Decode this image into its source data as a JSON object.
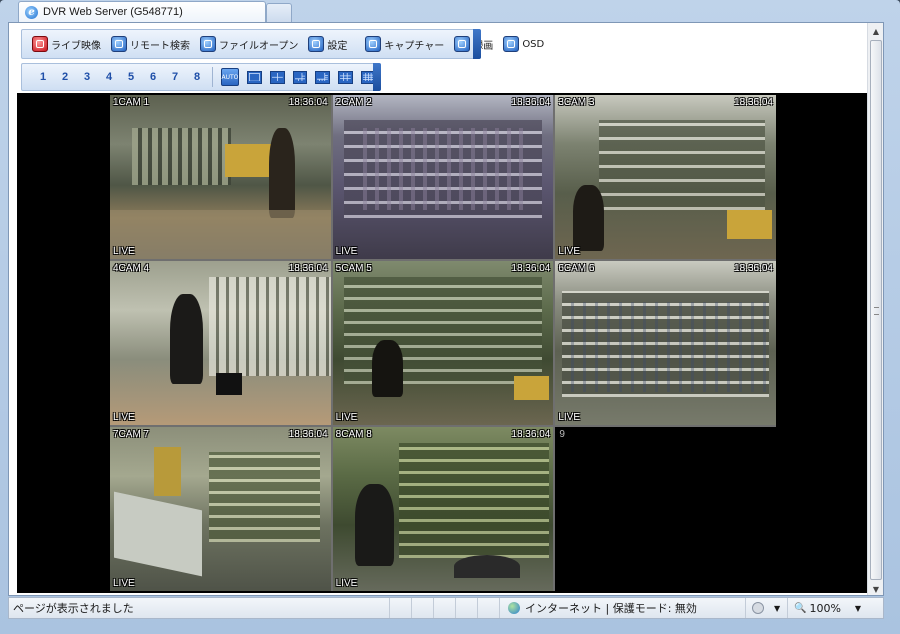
{
  "browser": {
    "tab_title": "DVR Web Server (G548771)"
  },
  "toolbar": {
    "main_buttons": [
      {
        "label": "ライブ映像",
        "icon": "live-video-icon",
        "color": "#c8101a"
      },
      {
        "label": "リモート検索",
        "icon": "remote-search-icon",
        "color": "#1f5fbf"
      },
      {
        "label": "ファイルオープン",
        "icon": "file-open-icon",
        "color": "#1f5fbf"
      },
      {
        "label": "設定",
        "icon": "settings-icon",
        "color": "#1f5fbf"
      },
      {
        "label": "キャプチャー",
        "icon": "capture-icon",
        "color": "#1f5fbf"
      },
      {
        "label": "録画",
        "icon": "record-icon",
        "color": "#1f5fbf"
      },
      {
        "label": "OSD",
        "icon": "osd-icon",
        "color": "#1f5fbf"
      }
    ],
    "channels": [
      "1",
      "2",
      "3",
      "4",
      "5",
      "6",
      "7",
      "8"
    ],
    "layouts": [
      "auto-sequence",
      "1x1",
      "2x2",
      "1+5",
      "1+7",
      "3x3",
      "4x4"
    ],
    "auto_label": "AUTO"
  },
  "cameras": [
    {
      "label": "1CAM 1",
      "time": "18:36:04",
      "status": "LIVE"
    },
    {
      "label": "2CAM 2",
      "time": "18:36:04",
      "status": "LIVE"
    },
    {
      "label": "3CAM 3",
      "time": "18:36:04",
      "status": "LIVE"
    },
    {
      "label": "4CAM 4",
      "time": "18:36:04",
      "status": "LIVE"
    },
    {
      "label": "5CAM 5",
      "time": "18:36:04",
      "status": "LIVE"
    },
    {
      "label": "6CAM 6",
      "time": "18:36:04",
      "status": "LIVE"
    },
    {
      "label": "7CAM 7",
      "time": "18:36:04",
      "status": "LIVE"
    },
    {
      "label": "8CAM 8",
      "time": "18:36:04",
      "status": "LIVE"
    }
  ],
  "empty_slot": {
    "label": "9"
  },
  "statusbar": {
    "message": "ページが表示されました",
    "zone": "インターネット | 保護モード: 無効",
    "zoom": "100%"
  }
}
